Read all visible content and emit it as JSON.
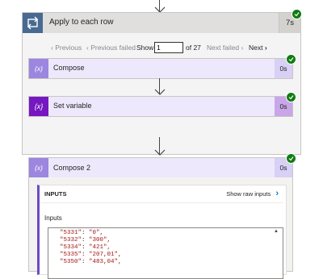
{
  "loop": {
    "title": "Apply to each row",
    "duration": "7s",
    "pager": {
      "previous": "Previous",
      "previous_failed": "Previous failed",
      "show": "Show",
      "page_value": "1",
      "of_total": "of 27",
      "next_failed": "Next failed",
      "next": "Next"
    }
  },
  "actions": [
    {
      "title": "Compose",
      "duration": "0s",
      "icon_text": "{x}",
      "color": "#9c86df"
    },
    {
      "title": "Set variable",
      "duration": "0s",
      "icon_text": "{x}",
      "color": "#7518c0"
    }
  ],
  "compose2": {
    "title": "Compose 2",
    "duration": "0s",
    "inputs_header": "INPUTS",
    "show_raw": "Show raw inputs",
    "inputs_label": "Inputs",
    "code_lines": [
      {
        "key": "\"5331\"",
        "value": "\"0\","
      },
      {
        "key": "\"5332\"",
        "value": "\"300\","
      },
      {
        "key": "\"5334\"",
        "value": "\"421\","
      },
      {
        "key": "\"5335\"",
        "value": "\"207,01\","
      },
      {
        "key": "\"5350\"",
        "value": "\"483,04\","
      }
    ]
  },
  "colors": {
    "loop_icon": "#486991",
    "success": "#107c10",
    "compose": "#9c86df",
    "set_variable": "#7518c0"
  }
}
